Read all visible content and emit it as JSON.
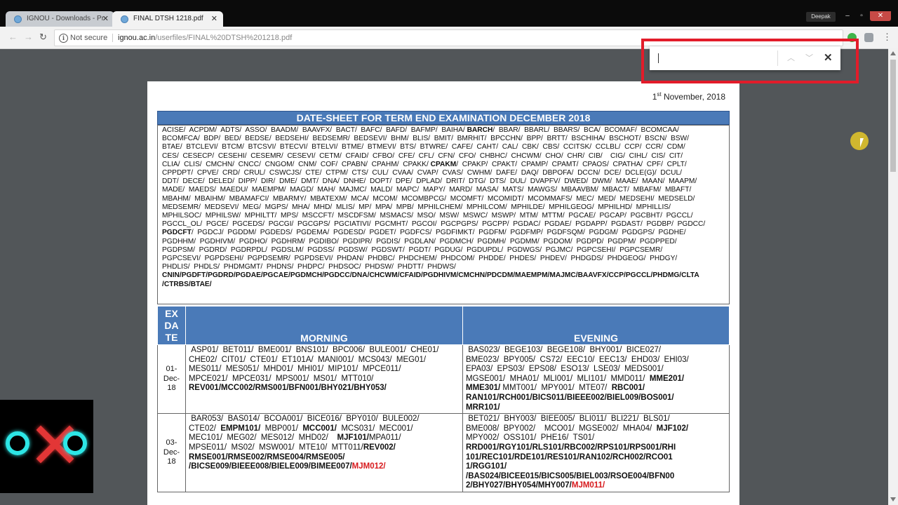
{
  "browser": {
    "tabs": [
      {
        "title": "IGNOU - Downloads - Pr",
        "active": false
      },
      {
        "title": "FINAL DTSH 1218.pdf",
        "active": true
      }
    ],
    "profile_name": "Deepak",
    "security_label": "Not secure",
    "url_host": "ignou.ac.in",
    "url_path": "/userfiles/FINAL%20DTSH%201218.pdf"
  },
  "find_bar": {
    "value": "",
    "prev_icon": "chevron-up-icon",
    "next_icon": "chevron-down-icon",
    "close_icon": "close-icon"
  },
  "document": {
    "date_day": "1",
    "date_suffix": "st",
    "date_rest": " November, 2018",
    "header": "DATE-SHEET FOR TERM END EXAMINATION DECEMBER 2018",
    "programs_lines": [
      "ACISE/  ACPDM/  ADTS/  ASSO/  BAADM/  BAAVFX/  BACT/  BAFC/  BAFD/  BAFMP/  BAIHA/ ",
      "BARCH",
      "/  BBAR/  BBARL/  BBARS/  BCA/  BCOMAF/  BCOMCAA/\nBCOMFCA/  BDP/  BED/  BEDSE/  BEDSEHI/  BEDSEMR/  BEDSEVI/  BHM/  BLIS/  BMIT/  BMRHIT/  BPCCHN/  BPP/  BRTT/  BSCHIHA/  BSCHOT/  BSCN/  BSW/\nBTAE/  BTCLEVI/  BTCM/  BTCSVI/  BTECVI/  BTELVI/  BTME/  BTMEVI/  BTS/  BTWRE/  CAFE/  CAHT/  CAL/  CBK/  CBS/  CCITSK/  CCLBL/  CCP/  CCR/  CDM/\nCES/  CESECP/  CESEHI/  CESEMR/  CESEVI/  CETM/  CFAID/  CFBO/  CFE/  CFL/  CFN/  CFO/  CHBHC/  CHCWM/  CHO/  CHR/  CIB/    CIG/  CIHL/  CIS/  CIT/\nCLIA/  CLIS/  CMCHN/  CNCC/  CNGOM/  CNM/  COF/  CPABN/  CPAHM/  CPAKK/ ",
      "CPAKM",
      "/  CPAKP/  CPAKT/  CPAMP/  CPAMT/  CPAOS/  CPATHA/  CPF/  CPLT/\nCPPDPT/  CPVE/  CRD/  CRUL/  CSWCJS/  CTE/  CTPM/  CTS/  CUL/  CVAA/  CVAP/  CVAS/  CWHM/  DAFE/  DAQ/  DBPOFA/  DCCN/  DCE/  DCLE(G)/  DCUL/\nDDT/  DECE/  DELED/  DIPP/  DIR/  DME/  DMT/  DNA/  DNHE/  DOPT/  DPE/  DPLAD/  DRIT/  DTG/  DTS/  DUL/  DVAPFV/  DWED/  DWM/  MAAE/  MAAN/  MAAPM/\nMADE/  MAEDS/  MAEDU/  MAEMPM/  MAGD/  MAH/  MAJMC/  MALD/  MAPC/  MAPY/  MARD/  MASA/  MATS/  MAWGS/  MBAAVBM/  MBACT/  MBAFM/  MBAFT/\nMBAHM/  MBAIHM/  MBAMAFCI/  MBARMY/  MBATEXM/  MCA/  MCOM/  MCOMBPCG/  MCOMFT/  MCOMIDT/  MCOMMAFS/  MEC/  MED/  MEDSEHI/  MEDSELD/\nMEDSEMR/  MEDSEVI/  MEG/  MGPS/  MHA/  MHD/  MLIS/  MP/  MPA/  MPB/  MPHILCHEM/  MPHILCOM/  MPHILDE/  MPHILGEOG/  MPHILHD/  MPHILLIS/\nMPHILSOC/  MPHILSW/  MPHILTT/  MPS/  MSCCFT/  MSCDFSM/  MSMACS/  MSO/  MSW/  MSWC/  MSWP/  MTM/  MTTM/  PGCAE/  PGCAP/  PGCBHT/  PGCCL/\nPGCCL_OL/  PGCE/  PGCEDS/  PGCGI/  PGCGPS/  PGCIATIVI/  PGCMHT/  PGCOI/  PGCPGPS/  PGCPP/  PGDAC/  PGDAE/  PGDAPP/  PGDAST/  PGDBP/  PGDCC/\n",
      "PGDCFT",
      "/  PGDCJ/  PGDDM/  PGDEDS/  PGDEMA/  PGDESD/  PGDET/  PGDFCS/  PGDFIMKT/  PGDFM/  PGDFMP/  PGDFSQM/  PGDGM/  PGDGPS/  PGDHE/\nPGDHHM/  PGDHIVM/  PGDHO/  PGDHRM/  PGDIBO/  PGDIPR/  PGDIS/  PGDLAN/  PGDMCH/  PGDMH/  PGDMM/  PGDOM/  PGDPD/  PGDPM/  PGDPPED/\nPGDPSM/  PGDRD/  PGDRPDL/  PGDSLM/  PGDSS/  PGDSW/  PGDSWT/  PGDT/  PGDUG/  PGDUPDL/  PGDWGS/  PGJMC/  PGPCSEHI/  PGPCSEMR/\nPGPCSEVI/  PGPDSEHI/  PGPDSEMR/  PGPDSEVI/  PHDAN/  PHDBC/  PHDCHEM/  PHDCOM/  PHDDE/  PHDES/  PHDEV/  PHDGDS/  PHDGEOG/  PHDGY/\nPHDLIS/  PHDLS/  PHDMGMT/  PHDNS/  PHDPC/  PHDSOC/  PHDSW/  PHDTT/  PHDWS/\n"
    ],
    "programs_extra": "CNIN/PGDFT/PGDRD/PGDAE/PGCAE/PGDMCH/PGDCC/DNA/CHCWM/CFAID/PGDHIVM/CMCHN/PDCDM/MAEMPM/MAJMC/BAAVFX/CCP/PGCCL/PHDMG/CLTA\n/CTRBS/BTAE/",
    "table": {
      "col_date": "EX\nDA\nTE",
      "col_morning": "MORNING",
      "col_evening": "EVENING",
      "rows": [
        {
          "date": "01-\nDec-\n18",
          "morning_plain": " ASP01/  BET011/  BME001/  BNS101/  BPC006/  BULE001/  CHE01/\nCHE02/  CIT01/  CTE01/  ET101A/  MANI001/  MCS043/  MEG01/\nMES011/  MES051/  MHD01/  MHI01/  MIP101/  MPCE011/\nMPCE021/  MPCE031/  MPS001/  MS01/  MTT010/\n",
          "morning_bold": "REV001/MCC002/RMS001/BFN001/BHY021/BHY053/",
          "morning_red": "",
          "evening_plain": " BAS023/  BEGE103/  BEGE108/  BHY001/  BICE027/\nBME023/  BPY005/  CS72/  EEC10/  EEC13/  EHD03/  EHI03/\nEPA03/  EPS03/  EPS08/  ESO13/  LSE03/  MEDS001/\nMGSE001/  MHA01/  MLI001/  MLI101/  MMD011/ ",
          "evening_bold": " MME201/\nMME301/",
          "evening_plain2": " MMT001/  MPY001/  MTE07/ ",
          "evening_bold2": " RBC001/\nRAN101/RCH001/BICS011/BIEEE002/BIEL009/BOS001/\nMRR101/",
          "evening_red": ""
        },
        {
          "date": "03-\nDec-\n18",
          "morning_plain": " BAR053/  BAS014/  BCOA001/  BICE016/  BPY010/  BULE002/\nCTE02/ ",
          "morning_bold": " EMPM101/",
          "morning_plain2": "  MBP001/ ",
          "morning_bold2": " MCC001/",
          "morning_plain3": "  MCS031/  MEC001/\nMEC101/  MEG02/  MES012/  MHD02/   ",
          "morning_bold3": " MJF101/",
          "morning_plain4": "MPA011/\nMPSE011/  MS02/  MSW001/  MTE10/  MTT011/",
          "morning_bold4": "REV002/\nRMSE001/RMSE002/RMSE004/RMSE005/\n/BICSE009/BIEEE008/BIELE009/BIMEE007/",
          "morning_red": "MJM012/",
          "evening_plain": " BET021/  BHY003/  BIEE005/  BLI011/  BLI221/  BLS01/\nBME008/  BPY002/    MCO01/  MGSE002/  MHA04/ ",
          "evening_bold": " MJF102/",
          "evening_plain2": "\nMPY002/  OSS101/  PHE16/  TS01/\n",
          "evening_bold2": "RRD001/RGY101/RLS101/RBC002/RPS101/RPS001/RHI\n101/REC101/RDE101/RES101/RAN102/RCH002/RCO01\n1/RGG101/\n/BAS024/BICEE015/BICS005/BIEL003/RSOE004/BFN00\n2/BHY027/BHY054/MHY007/",
          "evening_red": "MJM011/"
        }
      ]
    }
  },
  "colors": {
    "header_blue": "#4a7ab8",
    "highlight_red": "#e21c2a",
    "red_text": "#d7191c",
    "logo_cyan": "#2de6e6"
  }
}
